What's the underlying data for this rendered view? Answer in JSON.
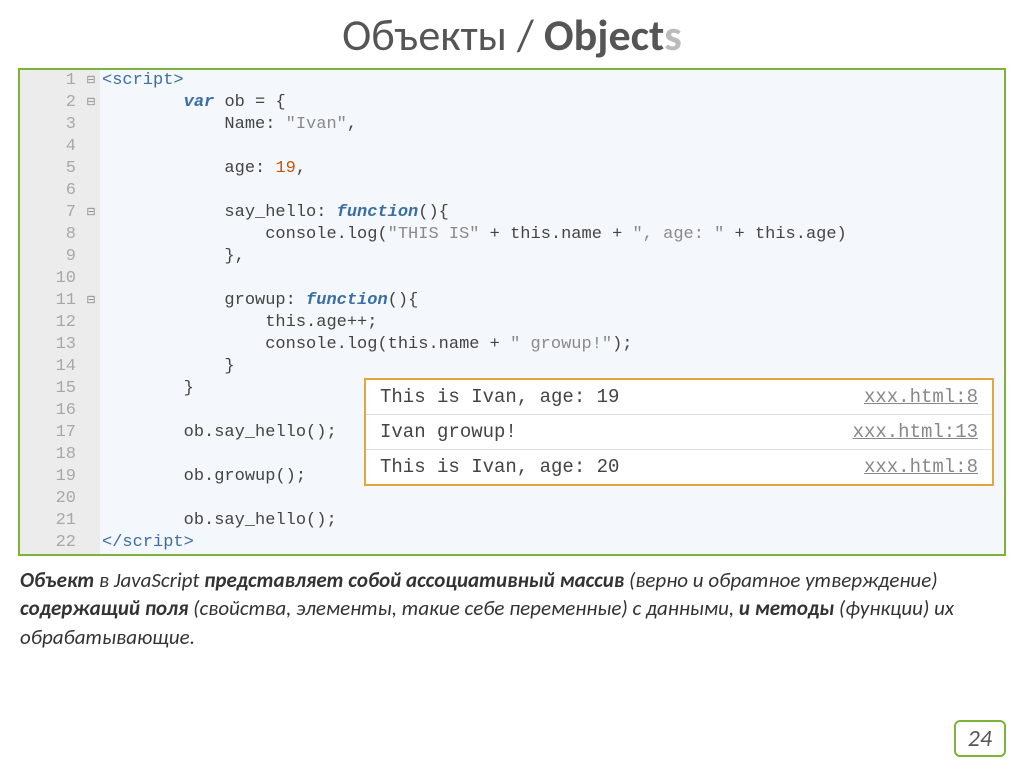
{
  "title": {
    "part1": "Объекты / ",
    "bold": "Object",
    "gray": "s"
  },
  "code": [
    {
      "n": "1",
      "fold": "⊟",
      "html": "<span class='tag'>&lt;script&gt;</span>"
    },
    {
      "n": "2",
      "fold": "⊟",
      "html": "        <span class='kw'>var</span> <span class='plain'>ob = {</span>"
    },
    {
      "n": "3",
      "fold": "",
      "html": "            <span class='plain'>Name: </span><span class='str'>\"Ivan\"</span><span class='plain'>,</span>"
    },
    {
      "n": "4",
      "fold": "",
      "html": ""
    },
    {
      "n": "5",
      "fold": "",
      "html": "            <span class='plain'>age: </span><span class='num'>19</span><span class='plain'>,</span>"
    },
    {
      "n": "6",
      "fold": "",
      "html": ""
    },
    {
      "n": "7",
      "fold": "⊟",
      "html": "            <span class='plain'>say_hello: </span><span class='func'>function</span><span class='plain'>(){</span>"
    },
    {
      "n": "8",
      "fold": "",
      "html": "                <span class='plain'>console.log(</span><span class='str'>\"THIS IS\"</span><span class='plain'> + this.name + </span><span class='str'>\", age: \"</span><span class='plain'> + this.age)</span>"
    },
    {
      "n": "9",
      "fold": "",
      "html": "            <span class='plain'>},</span>"
    },
    {
      "n": "10",
      "fold": "",
      "html": ""
    },
    {
      "n": "11",
      "fold": "⊟",
      "html": "            <span class='plain'>growup: </span><span class='func'>function</span><span class='plain'>(){</span>"
    },
    {
      "n": "12",
      "fold": "",
      "html": "                <span class='plain'>this.age++;</span>"
    },
    {
      "n": "13",
      "fold": "",
      "html": "                <span class='plain'>console.log(this.name + </span><span class='str'>\" growup!\"</span><span class='plain'>);</span>"
    },
    {
      "n": "14",
      "fold": "",
      "html": "            <span class='plain'>}</span>"
    },
    {
      "n": "15",
      "fold": "",
      "html": "        <span class='plain'>}</span>"
    },
    {
      "n": "16",
      "fold": "",
      "html": ""
    },
    {
      "n": "17",
      "fold": "",
      "html": "        <span class='plain'>ob.say_hello();</span>"
    },
    {
      "n": "18",
      "fold": "",
      "html": ""
    },
    {
      "n": "19",
      "fold": "",
      "html": "        <span class='plain'>ob.growup();</span>"
    },
    {
      "n": "20",
      "fold": "",
      "html": ""
    },
    {
      "n": "21",
      "fold": "",
      "html": "        <span class='plain'>ob.say_hello();</span>"
    },
    {
      "n": "22",
      "fold": "",
      "html": "<span class='tag'>&lt;/script&gt;</span>"
    }
  ],
  "console": [
    {
      "msg": "This is Ivan, age: 19",
      "src": "xxx.html:8"
    },
    {
      "msg": "Ivan growup!",
      "src": "xxx.html:13"
    },
    {
      "msg": "This is Ivan, age: 20",
      "src": "xxx.html:8"
    }
  ],
  "explain": {
    "line1_b1": "Объект",
    "line1_p1": " в JavaScript ",
    "line1_b2": "представляет собой ассоциативный массив",
    "line2_p1": " (верно и обратное утверждение) ",
    "line2_b1": "содержащий поля",
    "line2_p2": " (свойства, элементы, такие себе переменные) с данными, ",
    "line3_b1": "и методы",
    "line3_p1": " (функции) их обрабатывающие."
  },
  "page": "24"
}
